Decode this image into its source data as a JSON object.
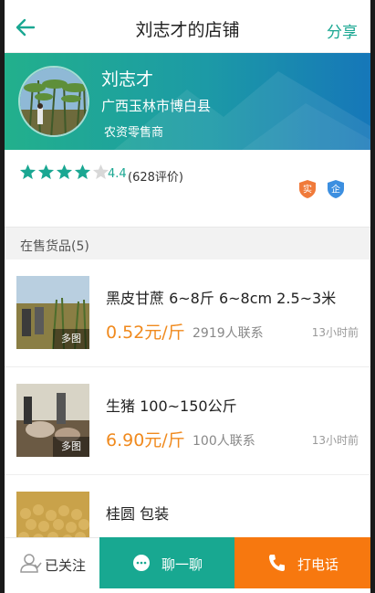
{
  "header": {
    "title": "刘志才的店铺",
    "share_label": "分享"
  },
  "profile": {
    "name": "刘志才",
    "location": "广西玉林市博白县",
    "role": "农资零售商"
  },
  "rating": {
    "stars": 4,
    "score": "4.4",
    "count_text": "(628评价)"
  },
  "badges": [
    {
      "label": "实",
      "color": "#f07a3a"
    },
    {
      "label": "企",
      "color": "#3c8fe0"
    }
  ],
  "section": {
    "title": "在售货品(5)"
  },
  "products": [
    {
      "name": "黑皮甘蔗 6~8斤 6~8cm 2.5~3米",
      "price": "0.52元/斤",
      "contacts": "2919人联系",
      "time": "13小时前",
      "tag": "多图"
    },
    {
      "name": "生猪 100~150公斤",
      "price": "6.90元/斤",
      "contacts": "100人联系",
      "time": "13小时前",
      "tag": "多图"
    },
    {
      "name": "桂圆 包装",
      "price": "",
      "contacts": "",
      "time": "",
      "tag": ""
    }
  ],
  "bottom": {
    "follow_label": "已关注",
    "chat_label": "聊一聊",
    "call_label": "打电话"
  },
  "colors": {
    "accent": "#1aa792",
    "price": "#f08a1e",
    "call": "#f7780f"
  }
}
